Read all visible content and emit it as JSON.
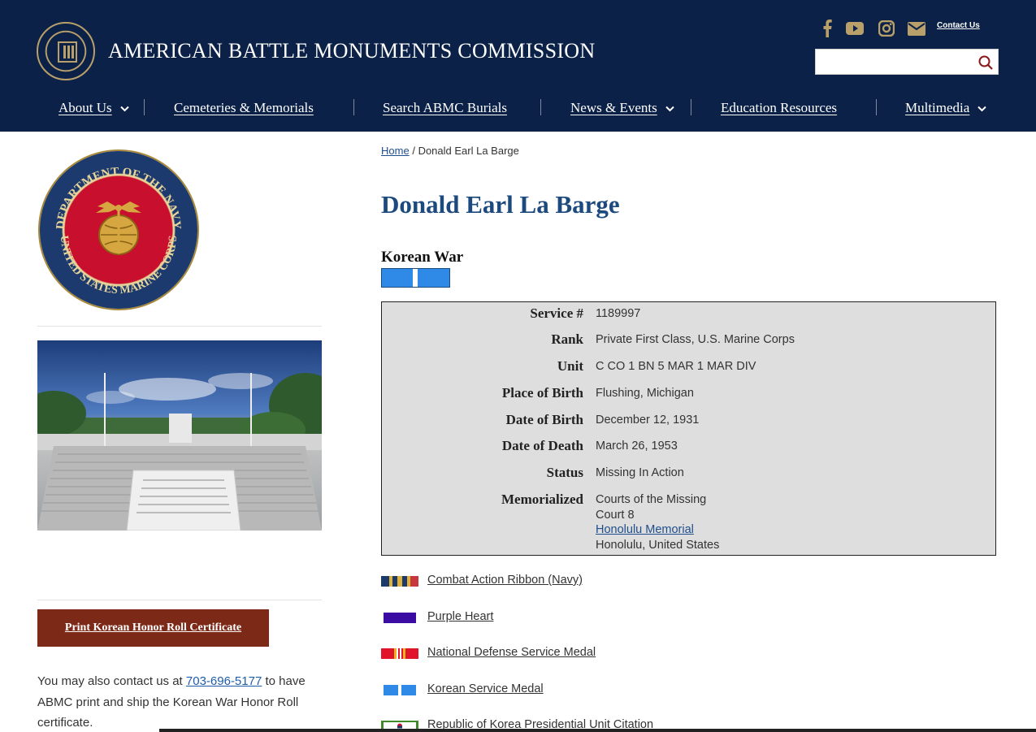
{
  "header": {
    "title": "AMERICAN BATTLE MONUMENTS COMMISSION",
    "contact_label": "Contact Us",
    "search": {
      "placeholder": "",
      "value": ""
    },
    "social": [
      "facebook-icon",
      "youtube-icon",
      "instagram-icon",
      "mail-icon"
    ],
    "background_color": "#0b2147"
  },
  "nav": {
    "items": [
      {
        "label": "About Us",
        "has_dropdown": true
      },
      {
        "label": "Cemeteries & Memorials",
        "has_dropdown": false
      },
      {
        "label": "Search ABMC Burials",
        "has_dropdown": false
      },
      {
        "label": "News & Events",
        "has_dropdown": true
      },
      {
        "label": "Education Resources",
        "has_dropdown": false
      },
      {
        "label": "Multimedia",
        "has_dropdown": true
      }
    ]
  },
  "breadcrumb": {
    "home": "Home",
    "separator": "/",
    "current": "Donald Earl La Barge"
  },
  "person": {
    "name": "Donald Earl La Barge",
    "war": "Korean War",
    "details": [
      {
        "label": "Service #",
        "values": [
          "1189997"
        ]
      },
      {
        "label": "Rank",
        "values": [
          "Private First Class, U.S. Marine Corps"
        ]
      },
      {
        "label": "Unit",
        "values": [
          "C CO 1 BN 5 MAR 1 MAR DIV"
        ]
      },
      {
        "label": "Place of Birth",
        "values": [
          "Flushing, Michigan"
        ]
      },
      {
        "label": "Date of Birth",
        "values": [
          "December 12, 1931"
        ]
      },
      {
        "label": "Date of Death",
        "values": [
          "March 26, 1953"
        ]
      },
      {
        "label": "Status",
        "values": [
          "Missing In Action"
        ]
      },
      {
        "label": "Memorialized",
        "values": [
          "Courts of the Missing",
          "Court 8"
        ],
        "link": "Honolulu Memorial",
        "location": "Honolulu, United States"
      }
    ]
  },
  "awards": [
    {
      "label": "Combat Action Ribbon (Navy)",
      "ribbon": "combat-action-ribbon"
    },
    {
      "label": "Purple Heart",
      "ribbon": "purple-heart-ribbon"
    },
    {
      "label": "National Defense Service Medal",
      "ribbon": "national-defense-ribbon"
    },
    {
      "label": "Korean Service Medal",
      "ribbon": "korean-service-ribbon"
    },
    {
      "label": "Republic of Korea Presidential Unit Citation",
      "ribbon": "korea-puc-ribbon"
    }
  ],
  "sidebar": {
    "seal_text_top": "DEPARTMENT OF THE NAVY",
    "seal_text_bottom": "UNITED STATES MARINE CORPS",
    "print_button": "Print Korean Honor Roll Certificate",
    "contact_pre": "You may also contact us at ",
    "phone": "703-696-5177",
    "contact_post": " to have ABMC print and ship the Korean War Honor Roll certificate."
  }
}
